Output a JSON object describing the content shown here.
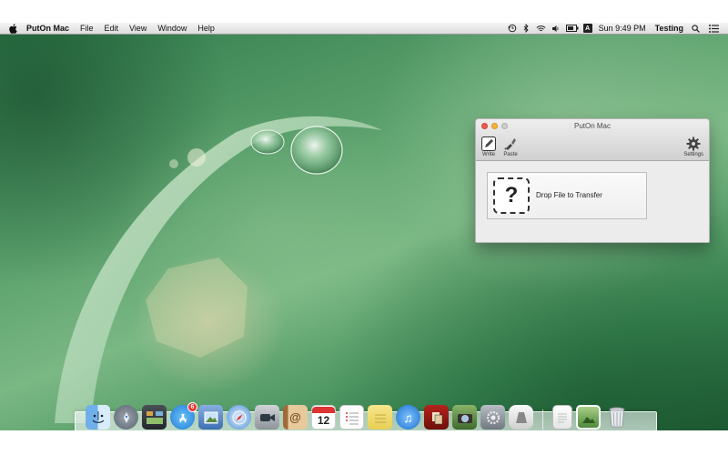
{
  "menubar": {
    "app_name": "PutOn Mac",
    "menus": [
      "File",
      "Edit",
      "View",
      "Window",
      "Help"
    ],
    "clock": "Sun 9:49 PM",
    "user": "Testing",
    "input_source": "A"
  },
  "window": {
    "title": "PutOn Mac",
    "toolbar": {
      "write_label": "Write",
      "paste_label": "Paste",
      "settings_label": "Settings"
    },
    "drop_zone": {
      "icon_glyph": "?",
      "text": "Drop File to Transfer"
    }
  },
  "dock": {
    "apps": [
      {
        "name": "finder-icon"
      },
      {
        "name": "launchpad-icon"
      },
      {
        "name": "mission-control-icon"
      },
      {
        "name": "app-store-icon",
        "badge": "6"
      },
      {
        "name": "preview-icon"
      },
      {
        "name": "safari-icon"
      },
      {
        "name": "facetime-icon"
      },
      {
        "name": "contacts-icon"
      },
      {
        "name": "calendar-icon",
        "label": "12"
      },
      {
        "name": "reminders-icon"
      },
      {
        "name": "notes-icon"
      },
      {
        "name": "itunes-icon"
      },
      {
        "name": "photo-booth-icon"
      },
      {
        "name": "iphoto-icon"
      },
      {
        "name": "system-preferences-icon"
      },
      {
        "name": "puton-mac-icon"
      }
    ],
    "stacks": [
      {
        "name": "documents-stack-icon"
      },
      {
        "name": "downloads-stack-icon"
      },
      {
        "name": "trash-icon"
      }
    ]
  },
  "colors": {
    "close": "#ef5b50",
    "minimize": "#f4b43a",
    "desktop_green": "#5aa06c",
    "badge_red": "#e33"
  }
}
